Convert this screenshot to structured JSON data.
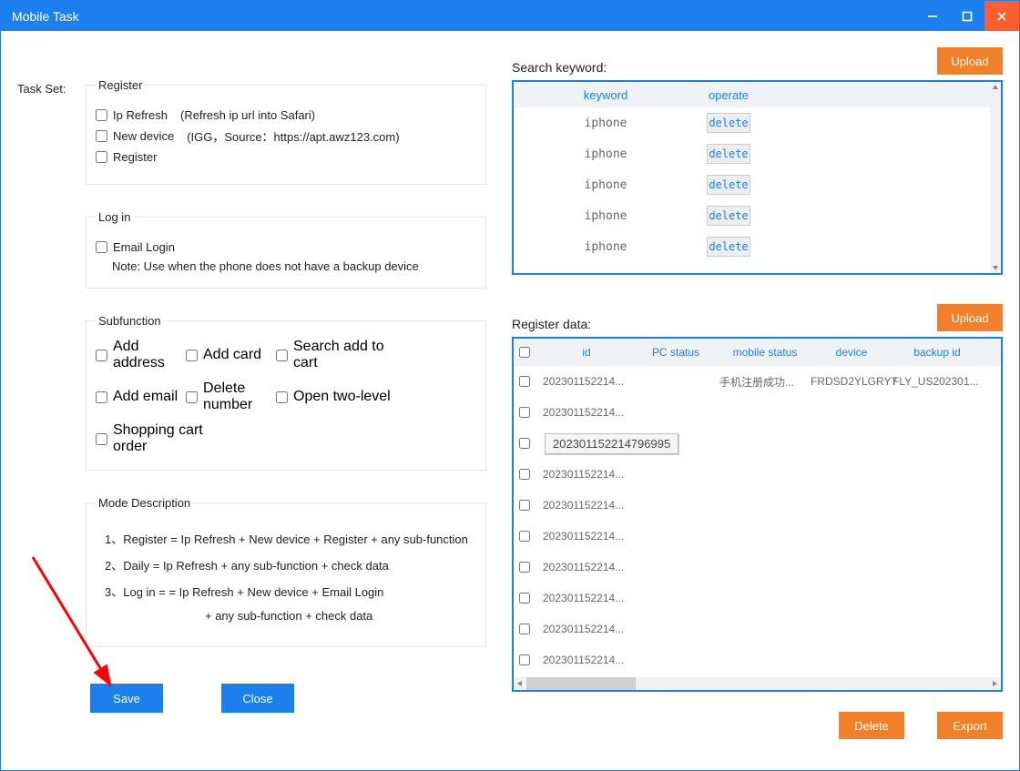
{
  "window": {
    "title": "Mobile Task"
  },
  "left": {
    "task_set_label": "Task Set:",
    "register": {
      "legend": "Register",
      "ip_refresh": "Ip Refresh",
      "ip_refresh_hint": "(Refresh ip url into Safari)",
      "new_device": "New device",
      "new_device_hint": "(IGG，Source：https://apt.awz123.com)",
      "register": "Register"
    },
    "login": {
      "legend": "Log in",
      "email_login": "Email Login",
      "note": "Note: Use when the phone does not have a backup device"
    },
    "subfn": {
      "legend": "Subfunction",
      "add_address": "Add address",
      "add_card": "Add card",
      "search_add_to_cart": "Search add to cart",
      "add_email": "Add email",
      "delete_number": "Delete number",
      "open_two_level": "Open two-level",
      "shopping_cart_order": "Shopping cart order"
    },
    "mode": {
      "legend": "Mode Description",
      "l1": "1、Register = Ip Refresh + New device + Register + any sub-function",
      "l2": "2、Daily =   Ip Refresh + any sub-function + check data",
      "l3": "3、Log in =  = Ip Refresh + New device + Email Login",
      "l4": "+ any sub-function + check data"
    },
    "buttons": {
      "save": "Save",
      "close": "Close"
    }
  },
  "right": {
    "keyword_title": "Search keyword:",
    "upload": "Upload",
    "kw_head": {
      "keyword": "keyword",
      "operate": "operate"
    },
    "kw_rows": [
      {
        "keyword": "iphone",
        "op": "delete"
      },
      {
        "keyword": "iphone",
        "op": "delete"
      },
      {
        "keyword": "iphone",
        "op": "delete"
      },
      {
        "keyword": "iphone",
        "op": "delete"
      },
      {
        "keyword": "iphone",
        "op": "delete"
      }
    ],
    "reg_title": "Register data:",
    "reg_head": {
      "id": "id",
      "pc_status": "PC status",
      "mobile_status": "mobile status",
      "device": "device",
      "backup_id": "backup id"
    },
    "reg_rows": [
      {
        "id": "202301152214...",
        "pc": "",
        "mobile": "手机注册成功...",
        "device": "FRDSD2YLGRY7",
        "backup": "FLY_US202301..."
      },
      {
        "id": "202301152214...",
        "pc": "",
        "mobile": "",
        "device": "",
        "backup": ""
      },
      {
        "id": "202301152214796995",
        "pc": "",
        "mobile": "",
        "device": "",
        "backup": "",
        "expanded": true
      },
      {
        "id": "202301152214...",
        "pc": "",
        "mobile": "",
        "device": "",
        "backup": ""
      },
      {
        "id": "202301152214...",
        "pc": "",
        "mobile": "",
        "device": "",
        "backup": ""
      },
      {
        "id": "202301152214...",
        "pc": "",
        "mobile": "",
        "device": "",
        "backup": ""
      },
      {
        "id": "202301152214...",
        "pc": "",
        "mobile": "",
        "device": "",
        "backup": ""
      },
      {
        "id": "202301152214...",
        "pc": "",
        "mobile": "",
        "device": "",
        "backup": ""
      },
      {
        "id": "202301152214...",
        "pc": "",
        "mobile": "",
        "device": "",
        "backup": ""
      },
      {
        "id": "202301152214...",
        "pc": "",
        "mobile": "",
        "device": "",
        "backup": ""
      }
    ],
    "bottom": {
      "delete": "Delete",
      "export": "Export"
    }
  }
}
